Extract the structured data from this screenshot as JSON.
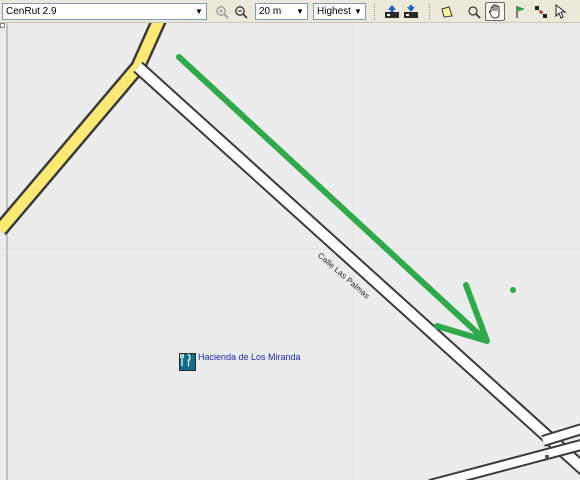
{
  "toolbar": {
    "map_selector": {
      "value": "CenRut 2.9"
    },
    "zoom_in_icon": "zoom-in-icon",
    "zoom_out_icon": "zoom-out-icon",
    "scale_selector": {
      "value": "20 m"
    },
    "detail_selector": {
      "value": "Highest"
    },
    "tools": [
      {
        "name": "send-to-device-icon"
      },
      {
        "name": "receive-from-device-icon"
      },
      {
        "name": "select-map-icon"
      },
      {
        "name": "zoom-tool-icon"
      },
      {
        "name": "pan-tool-icon"
      },
      {
        "name": "waypoint-flag-icon"
      },
      {
        "name": "route-tool-icon"
      },
      {
        "name": "pointer-icon"
      }
    ],
    "active_tool": "pan-tool-icon"
  },
  "map": {
    "street_label": "Calle Las Palmas",
    "poi": {
      "label": "Hacienda de Los Miranda",
      "icon": "restaurant-icon"
    },
    "colors": {
      "background": "#ececec",
      "major_road": "#fbe976",
      "road_casing": "#3a3a3a",
      "minor_road": "#ffffff",
      "annotation_arrow": "#2eaa4a",
      "poi_text": "#1a2bb8"
    }
  }
}
